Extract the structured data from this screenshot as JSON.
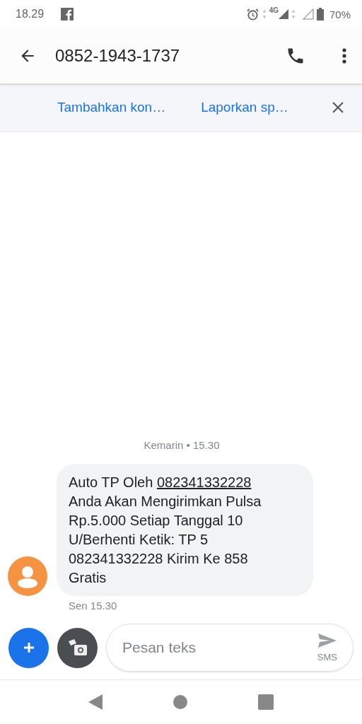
{
  "status_bar": {
    "time": "18.29",
    "network": "4G",
    "battery": "70%"
  },
  "app_bar": {
    "title": "0852-1943-1737"
  },
  "banner": {
    "actions": [
      "Tambahkan kon…",
      "Laporkan sp…"
    ]
  },
  "conversation": {
    "date_header": "Kemarin • 15.30",
    "messages": [
      {
        "segments": [
          {
            "kind": "text",
            "text": "Auto TP Oleh "
          },
          {
            "kind": "link",
            "text": "082341332228"
          },
          {
            "kind": "text",
            "text": " Anda Akan Mengirimkan Pulsa Rp.5.000 Setiap Tanggal 10 U/Berhenti Ketik: TP 5 082341332228 Kirim Ke 858 Gratis"
          }
        ],
        "time": "Sen 15.30"
      }
    ]
  },
  "composer": {
    "placeholder": "Pesan teks",
    "send_label": "SMS"
  }
}
